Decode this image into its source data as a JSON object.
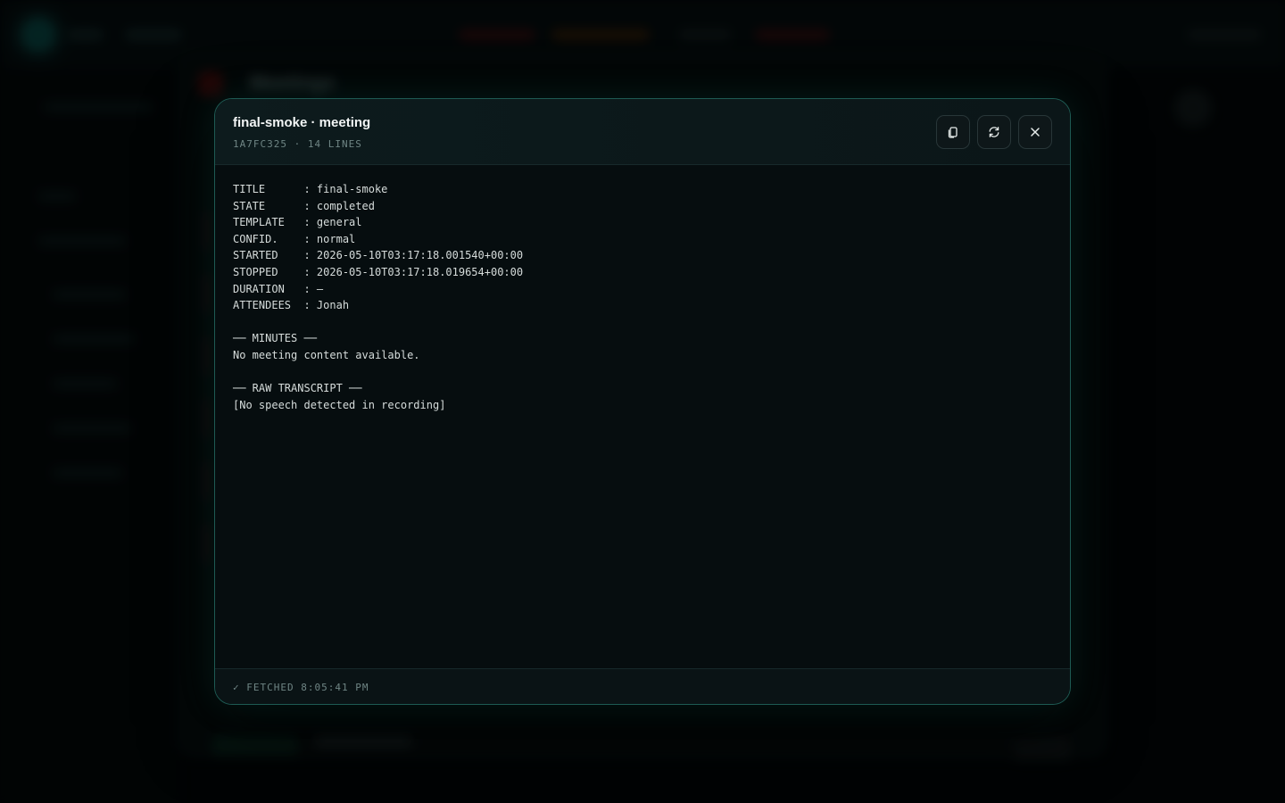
{
  "background": {
    "panel_title": "Meetings"
  },
  "modal": {
    "title": "final-smoke · meeting",
    "subtitle": "1A7FC325 · 14 LINES",
    "buttons": {
      "copy_icon": "copy-icon",
      "refresh_icon": "refresh-icon",
      "close_icon": "close-icon"
    },
    "fields": [
      {
        "key": "TITLE",
        "value": "final-smoke"
      },
      {
        "key": "STATE",
        "value": "completed"
      },
      {
        "key": "TEMPLATE",
        "value": "general"
      },
      {
        "key": "CONFID.",
        "value": "normal"
      },
      {
        "key": "STARTED",
        "value": "2026-05-10T03:17:18.001540+00:00"
      },
      {
        "key": "STOPPED",
        "value": "2026-05-10T03:17:18.019654+00:00"
      },
      {
        "key": "DURATION",
        "value": "—"
      },
      {
        "key": "ATTENDEES",
        "value": "Jonah"
      }
    ],
    "minutes_heading": "── MINUTES ──",
    "minutes_text": "No meeting content available.",
    "transcript_heading": "── RAW TRANSCRIPT ──",
    "transcript_text": "[No speech detected in recording]",
    "footer": "✓ FETCHED 8:05:41 PM"
  },
  "colors": {
    "accent_border": "#1e5a53",
    "text_primary": "#d6dcdb",
    "text_muted": "#6f8584"
  }
}
